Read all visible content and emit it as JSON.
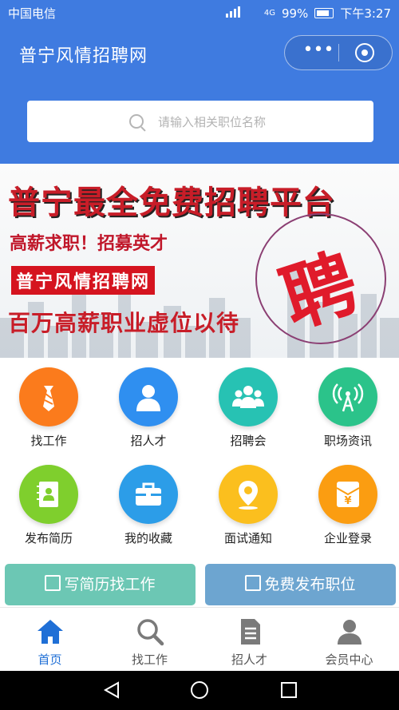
{
  "status": {
    "carrier": "中国电信",
    "battery": "99%",
    "time": "下午3:27",
    "signal": "4G"
  },
  "app": {
    "title": "普宁风情招聘网"
  },
  "search": {
    "placeholder": "请输入相关职位名称"
  },
  "banner": {
    "headline": "普宁最全免费招聘平台",
    "subline": "高薪求职！招募英才",
    "brand": "普宁风情招聘网",
    "tagline": "百万高薪职业虚位以待",
    "stamp": "聘"
  },
  "grid": [
    {
      "label": "找工作",
      "icon": "tie-icon",
      "color": "#fb7b1c"
    },
    {
      "label": "招人才",
      "icon": "person-icon",
      "color": "#2f8ff0"
    },
    {
      "label": "招聘会",
      "icon": "group-icon",
      "color": "#27c2b3"
    },
    {
      "label": "职场资讯",
      "icon": "broadcast-icon",
      "color": "#2bc38a"
    },
    {
      "label": "发布简历",
      "icon": "resume-book-icon",
      "color": "#7fcf2d"
    },
    {
      "label": "我的收藏",
      "icon": "briefcase-icon",
      "color": "#2c9de8"
    },
    {
      "label": "面试通知",
      "icon": "location-pin-icon",
      "color": "#fbbf1e"
    },
    {
      "label": "企业登录",
      "icon": "yen-envelope-icon",
      "color": "#fb9d11"
    }
  ],
  "actions": {
    "write_resume": "写简历找工作",
    "post_job": "免费发布职位",
    "write_resume_color": "#6cc7b4",
    "post_job_color": "#6da5d0"
  },
  "tabs": [
    {
      "label": "首页",
      "icon": "home-icon"
    },
    {
      "label": "找工作",
      "icon": "search-icon"
    },
    {
      "label": "招人才",
      "icon": "document-icon"
    },
    {
      "label": "会员中心",
      "icon": "user-icon"
    }
  ],
  "theme": {
    "primary": "#3f7be0",
    "tab_active": "#1f6fd6"
  }
}
